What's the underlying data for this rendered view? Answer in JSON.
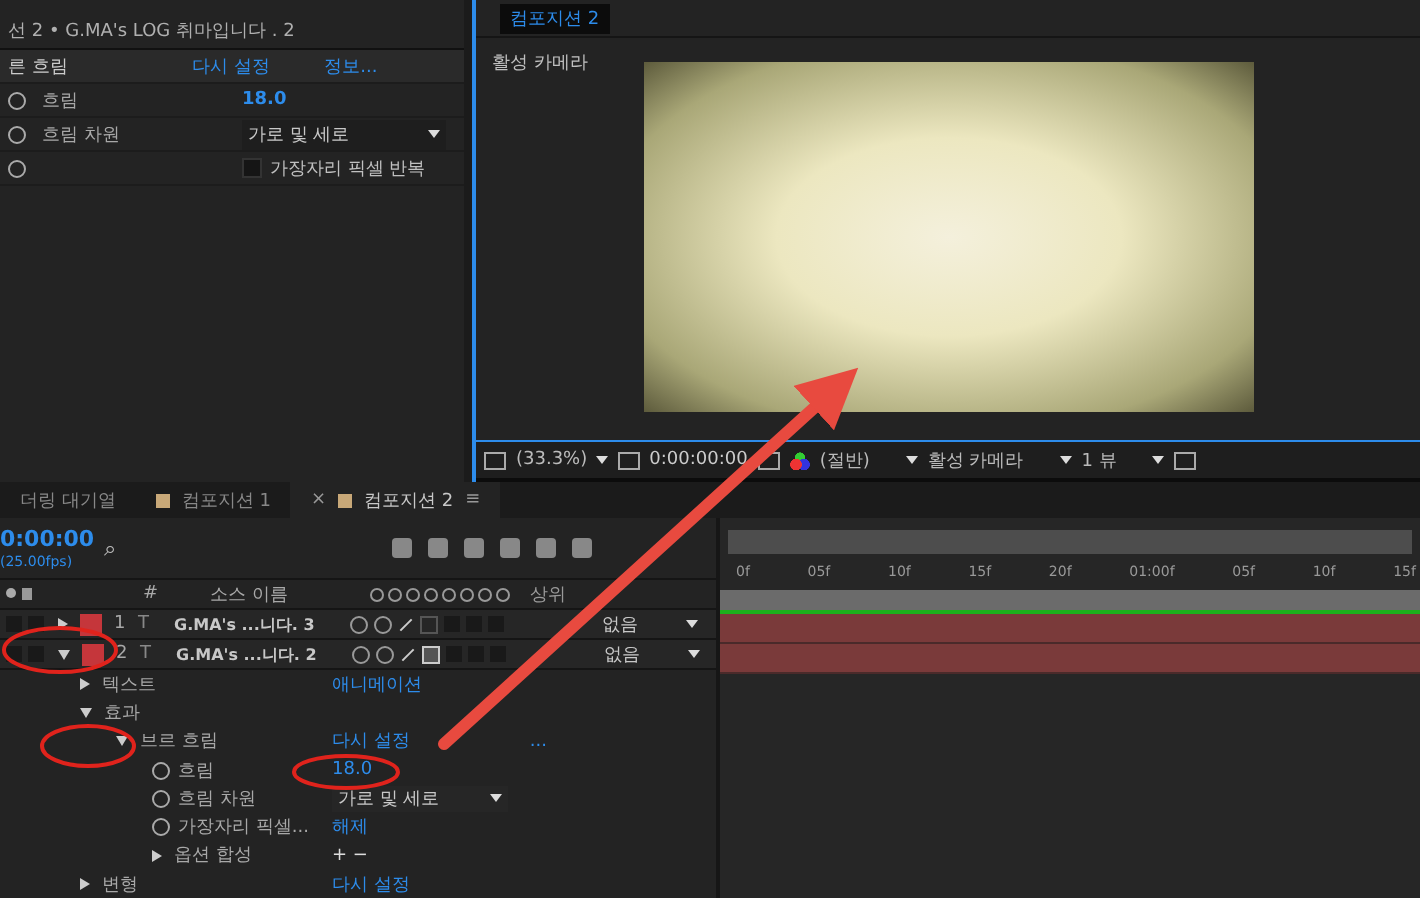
{
  "effect_controls": {
    "title": "선 2 • G.MA's LOG 취마입니다 . 2",
    "effect": {
      "name": "른 흐림",
      "reset": "다시 설정",
      "about": "정보..."
    },
    "rows": [
      {
        "kind": "value",
        "label": "흐림",
        "value": "18.0"
      },
      {
        "kind": "dropdown",
        "label": "흐림 차원",
        "value": "가로 및 세로"
      },
      {
        "kind": "checkbox",
        "checked": false,
        "text": "가장자리 픽셀 반복"
      }
    ]
  },
  "viewer": {
    "tab": "컴포지션 2",
    "camera_label": "활성 카메라",
    "zoom": "(33.3%)",
    "time": "0:00:00:00",
    "resolution": "(절반)",
    "camera": "활성 카메라",
    "views": "1 뷰"
  },
  "timeline": {
    "tabs": [
      {
        "label": "더링 대기열",
        "selected": false
      },
      {
        "label": "컴포지션 1",
        "selected": false,
        "kind": "composition"
      },
      {
        "label": "컴포지션 2",
        "selected": true,
        "kind": "composition",
        "close": "×",
        "menu": "≡"
      }
    ],
    "timecode": "0:00:00",
    "fps": "(25.00fps)",
    "search_icon": "⌕",
    "column_number": "#",
    "column_name": "소스 이름",
    "column_parent": "상위",
    "layers": [
      {
        "number": "1",
        "icon": "T",
        "name": "G.MA's ...니다. 3",
        "expanded": false,
        "fx": false,
        "parent": "없음"
      },
      {
        "number": "2",
        "icon": "T",
        "name": "G.MA's ...니다. 2",
        "expanded": true,
        "fx": true,
        "parent": "없음"
      }
    ],
    "properties": [
      {
        "label": "텍스트",
        "expanded": false,
        "value": "애니메이션",
        "kind": "link"
      },
      {
        "label": "효과",
        "expanded": true,
        "children": [
          {
            "label": "브르 흐림",
            "expanded": true,
            "value": "다시 설정",
            "extra": "...",
            "kind": "link",
            "children": [
              {
                "label": "흐림",
                "kind": "value",
                "value": "18.0",
                "stopwatch": true
              },
              {
                "label": "흐림 차원",
                "kind": "dropdown",
                "value": "가로 및 세로",
                "stopwatch": true
              },
              {
                "label": "가장자리 픽셀...",
                "kind": "value",
                "value": "해제",
                "stopwatch": true
              },
              {
                "label": "옵션 합성",
                "expanded": false,
                "kind": "plain",
                "value": "+ −"
              }
            ]
          }
        ]
      },
      {
        "label": "변형",
        "expanded": false,
        "kind": "link",
        "value": "다시 설정"
      }
    ],
    "ruler": [
      "0f",
      "05f",
      "10f",
      "15f",
      "20f",
      "01:00f",
      "05f",
      "10f",
      "15f"
    ]
  }
}
